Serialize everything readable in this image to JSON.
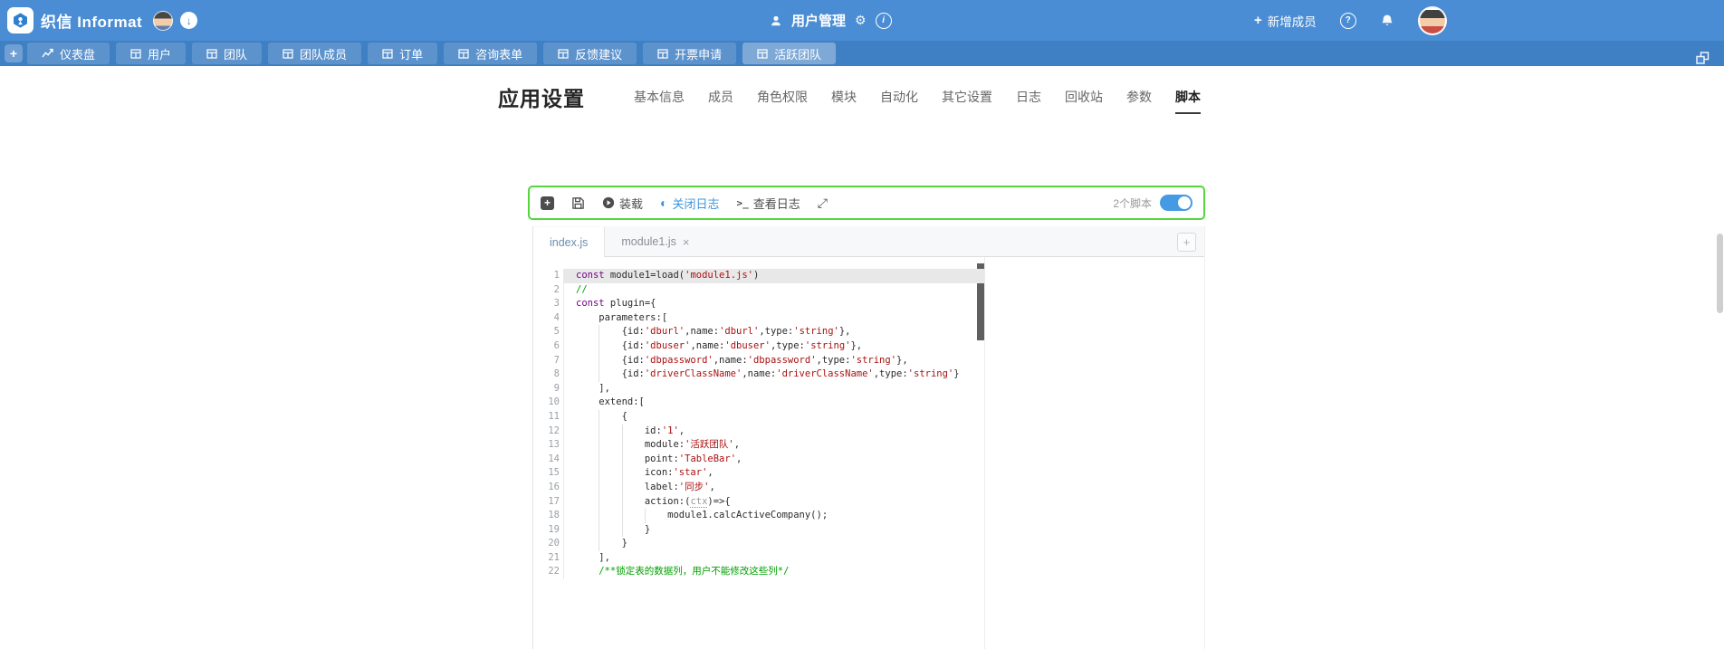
{
  "header": {
    "brand": "织信 Informat",
    "app_title": "用户管理",
    "add_member_label": "新增成员"
  },
  "icons": {
    "new_member_plus": "+",
    "nav_add_plus": "+",
    "plus_square": "+",
    "toggle_log": "◐",
    "terminal": ">_",
    "expand": "⤢",
    "gear": "⚙",
    "info": "i",
    "help": "?",
    "download_arrow": "↓",
    "add_tab": "+",
    "close_tab": "×"
  },
  "navbar": {
    "tabs": [
      {
        "label": "仪表盘",
        "icon": "line-chart-icon",
        "active": false
      },
      {
        "label": "用户",
        "icon": "table-icon",
        "active": false
      },
      {
        "label": "团队",
        "icon": "table-icon",
        "active": false
      },
      {
        "label": "团队成员",
        "icon": "table-icon",
        "active": false
      },
      {
        "label": "订单",
        "icon": "table-icon",
        "active": false
      },
      {
        "label": "咨询表单",
        "icon": "table-icon",
        "active": false
      },
      {
        "label": "反馈建议",
        "icon": "table-icon",
        "active": false
      },
      {
        "label": "开票申请",
        "icon": "table-icon",
        "active": false
      },
      {
        "label": "活跃团队",
        "icon": "table-icon",
        "active": true
      }
    ]
  },
  "settings": {
    "title": "应用设置",
    "tabs": [
      {
        "label": "基本信息",
        "active": false
      },
      {
        "label": "成员",
        "active": false
      },
      {
        "label": "角色权限",
        "active": false
      },
      {
        "label": "模块",
        "active": false
      },
      {
        "label": "自动化",
        "active": false
      },
      {
        "label": "其它设置",
        "active": false
      },
      {
        "label": "日志",
        "active": false
      },
      {
        "label": "回收站",
        "active": false
      },
      {
        "label": "参数",
        "active": false
      },
      {
        "label": "脚本",
        "active": true
      }
    ]
  },
  "toolbar": {
    "load_label": "装载",
    "log_toggle_label": "关闭日志",
    "view_log_label": "查看日志",
    "script_count": "2个脚本",
    "scripts_enabled": true
  },
  "editor": {
    "tabs": [
      {
        "label": "index.js",
        "active": true,
        "closable": false
      },
      {
        "label": "module1.js",
        "active": false,
        "closable": true
      }
    ],
    "code_lines": [
      {
        "n": 1,
        "active": true,
        "g": 0,
        "tokens": [
          [
            "k",
            "const"
          ],
          [
            "p",
            " module1=load("
          ],
          [
            "s",
            "'module1.js'"
          ],
          [
            "p",
            ")"
          ]
        ]
      },
      {
        "n": 2,
        "g": 0,
        "tokens": [
          [
            "c",
            "//"
          ]
        ]
      },
      {
        "n": 3,
        "g": 0,
        "tokens": [
          [
            "k",
            "const"
          ],
          [
            "p",
            " plugin={"
          ]
        ]
      },
      {
        "n": 4,
        "g": 0,
        "tokens": [
          [
            "p",
            "    parameters:["
          ]
        ]
      },
      {
        "n": 5,
        "g": 1,
        "tokens": [
          [
            "p",
            "        {id:"
          ],
          [
            "s",
            "'dburl'"
          ],
          [
            "p",
            ",name:"
          ],
          [
            "s",
            "'dburl'"
          ],
          [
            "p",
            ",type:"
          ],
          [
            "s",
            "'string'"
          ],
          [
            "p",
            "},"
          ]
        ]
      },
      {
        "n": 6,
        "g": 1,
        "tokens": [
          [
            "p",
            "        {id:"
          ],
          [
            "s",
            "'dbuser'"
          ],
          [
            "p",
            ",name:"
          ],
          [
            "s",
            "'dbuser'"
          ],
          [
            "p",
            ",type:"
          ],
          [
            "s",
            "'string'"
          ],
          [
            "p",
            "},"
          ]
        ]
      },
      {
        "n": 7,
        "g": 1,
        "tokens": [
          [
            "p",
            "        {id:"
          ],
          [
            "s",
            "'dbpassword'"
          ],
          [
            "p",
            ",name:"
          ],
          [
            "s",
            "'dbpassword'"
          ],
          [
            "p",
            ",type:"
          ],
          [
            "s",
            "'string'"
          ],
          [
            "p",
            "},"
          ]
        ]
      },
      {
        "n": 8,
        "g": 1,
        "tokens": [
          [
            "p",
            "        {id:"
          ],
          [
            "s",
            "'driverClassName'"
          ],
          [
            "p",
            ",name:"
          ],
          [
            "s",
            "'driverClassName'"
          ],
          [
            "p",
            ",type:"
          ],
          [
            "s",
            "'string'"
          ],
          [
            "p",
            "}"
          ]
        ]
      },
      {
        "n": 9,
        "g": 0,
        "tokens": [
          [
            "p",
            "    ],"
          ]
        ]
      },
      {
        "n": 10,
        "g": 0,
        "tokens": [
          [
            "p",
            "    extend:["
          ]
        ]
      },
      {
        "n": 11,
        "g": 1,
        "tokens": [
          [
            "p",
            "        {"
          ]
        ]
      },
      {
        "n": 12,
        "g": 2,
        "tokens": [
          [
            "p",
            "            id:"
          ],
          [
            "s",
            "'1'"
          ],
          [
            "p",
            ","
          ]
        ]
      },
      {
        "n": 13,
        "g": 2,
        "tokens": [
          [
            "p",
            "            module:"
          ],
          [
            "s",
            "'活跃团队'"
          ],
          [
            "p",
            ","
          ]
        ]
      },
      {
        "n": 14,
        "g": 2,
        "tokens": [
          [
            "p",
            "            point:"
          ],
          [
            "s",
            "'TableBar'"
          ],
          [
            "p",
            ","
          ]
        ]
      },
      {
        "n": 15,
        "g": 2,
        "tokens": [
          [
            "p",
            "            icon:"
          ],
          [
            "s",
            "'star'"
          ],
          [
            "p",
            ","
          ]
        ]
      },
      {
        "n": 16,
        "g": 2,
        "tokens": [
          [
            "p",
            "            label:"
          ],
          [
            "s",
            "'同步'"
          ],
          [
            "p",
            ","
          ]
        ]
      },
      {
        "n": 17,
        "g": 2,
        "tokens": [
          [
            "p",
            "            action:("
          ],
          [
            "d",
            "ctx"
          ],
          [
            "p",
            ")=>{"
          ]
        ]
      },
      {
        "n": 18,
        "g": 3,
        "tokens": [
          [
            "p",
            "                module1.calcActiveCompany();"
          ]
        ]
      },
      {
        "n": 19,
        "g": 2,
        "tokens": [
          [
            "p",
            "            }"
          ]
        ]
      },
      {
        "n": 20,
        "g": 1,
        "tokens": [
          [
            "p",
            "        }"
          ]
        ]
      },
      {
        "n": 21,
        "g": 0,
        "tokens": [
          [
            "p",
            "    ],"
          ]
        ]
      },
      {
        "n": 22,
        "g": 0,
        "tokens": [
          [
            "c",
            "    /**锁定表的数据列，用户不能修改这些列*/"
          ]
        ]
      }
    ]
  },
  "colors": {
    "header_blue": "#4a8dd4",
    "nav_blue": "#3f7fc4",
    "accent_blue": "#449be4",
    "toolbar_green": "#54d63f",
    "keyword": "#770088",
    "string": "#aa1111",
    "comment": "#00a000"
  }
}
